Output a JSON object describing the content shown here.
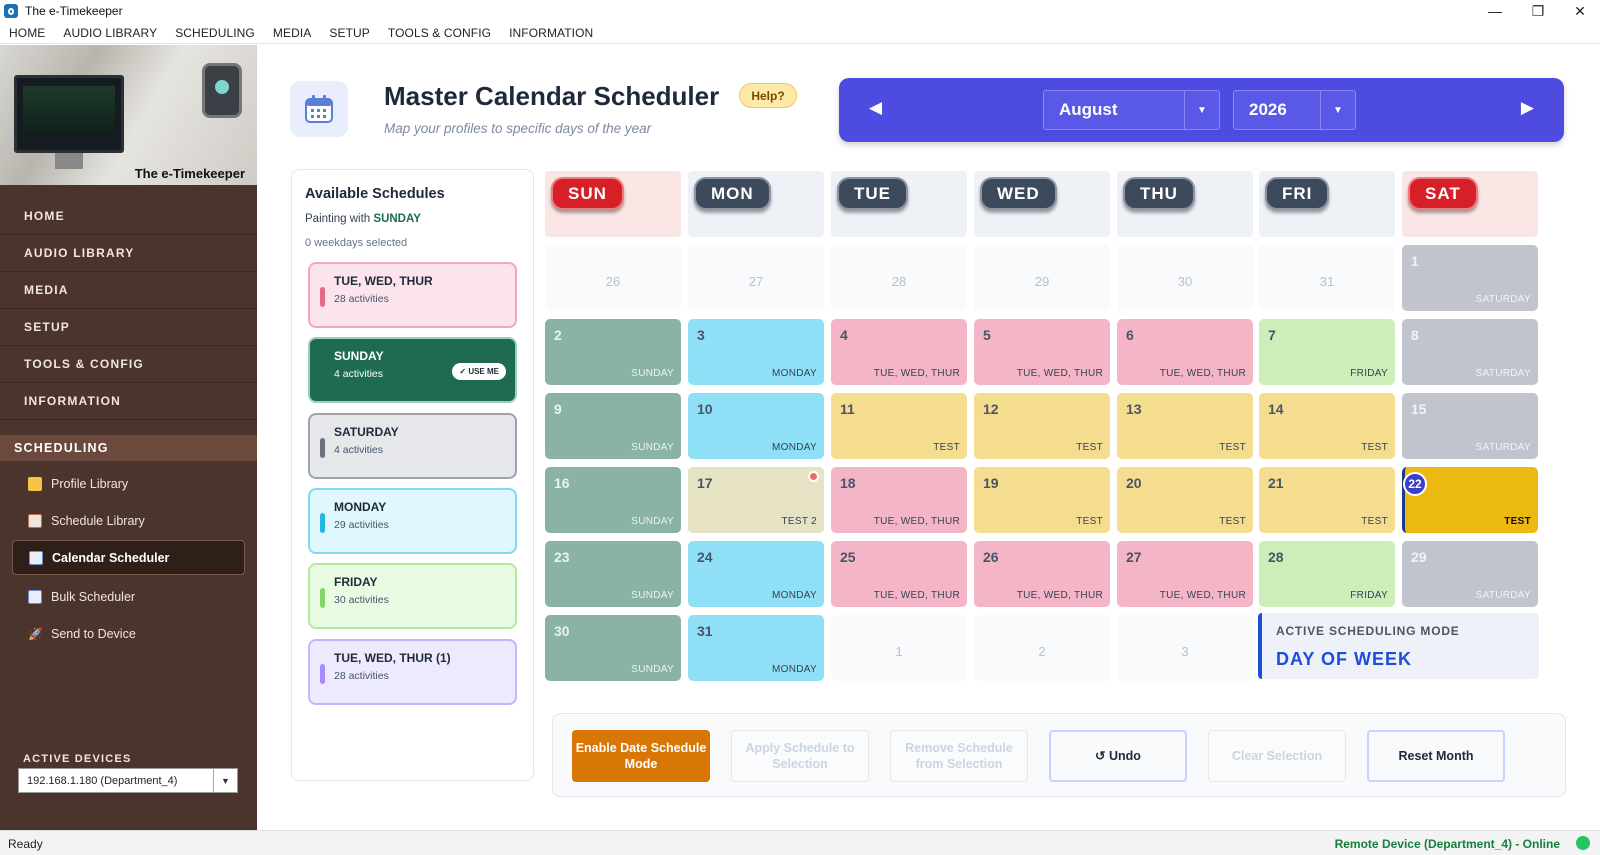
{
  "window": {
    "title": "The e-Timekeeper",
    "minimize": "—",
    "maximize": "❐",
    "close": "✕"
  },
  "menubar": [
    "HOME",
    "AUDIO LIBRARY",
    "SCHEDULING",
    "MEDIA",
    "SETUP",
    "TOOLS & CONFIG",
    "INFORMATION"
  ],
  "sidebar": {
    "banner_label": "The e-Timekeeper",
    "nav": [
      "HOME",
      "AUDIO LIBRARY",
      "MEDIA",
      "SETUP",
      "TOOLS & CONFIG",
      "INFORMATION"
    ],
    "section": "SCHEDULING",
    "sub_items": [
      {
        "label": "Profile Library",
        "icon": "folder-icon",
        "color": "#f5c542"
      },
      {
        "label": "Schedule Library",
        "icon": "document-icon",
        "color": "#f1e6dc"
      },
      {
        "label": "Calendar Scheduler",
        "icon": "calendar-icon",
        "color": "#9bb7e6"
      },
      {
        "label": "Bulk Scheduler",
        "icon": "calendar-icon",
        "color": "#9bb7e6"
      },
      {
        "label": "Send to Device",
        "icon": "rocket-icon",
        "color": "#e26b6b"
      }
    ],
    "active_devices_label": "ACTIVE DEVICES",
    "device_value": "192.168.1.180  (Department_4)"
  },
  "header": {
    "title": "Master Calendar Scheduler",
    "help": "Help?",
    "subtitle": "Map your profiles to specific days of the year"
  },
  "month_nav": {
    "month": "August",
    "year": "2026",
    "prev": "◀",
    "next": "▶"
  },
  "available": {
    "title": "Available Schedules",
    "painting_prefix": "Painting with ",
    "painting_value": "SUNDAY",
    "weekdays_selected": "0 weekdays selected",
    "use_me": "✓ USE ME",
    "cards": [
      {
        "name": "TUE, WED, THUR",
        "activities": "28 activities",
        "bg": "#fce4ec",
        "border": "#f4a6bd",
        "bar": "#e36b8a"
      },
      {
        "name": "SUNDAY",
        "activities": "4 activities",
        "bg": "#1e6b52",
        "border": "#9ad0bf",
        "bar": "#1e6b52",
        "selected": true
      },
      {
        "name": "SATURDAY",
        "activities": "4 activities",
        "bg": "#e5e7eb",
        "border": "#9ca3af",
        "bar": "#6b7280"
      },
      {
        "name": "MONDAY",
        "activities": "29 activities",
        "bg": "#e0f7fd",
        "border": "#7fdaf2",
        "bar": "#22b8e0"
      },
      {
        "name": "FRIDAY",
        "activities": "30 activities",
        "bg": "#eafbe4",
        "border": "#b6e8a3",
        "bar": "#86d36a"
      },
      {
        "name": "TUE, WED, THUR (1)",
        "activities": "28 activities",
        "bg": "#ede9fe",
        "border": "#c4b5fd",
        "bar": "#a78bfa"
      }
    ]
  },
  "calendar": {
    "day_headers": [
      "SUN",
      "MON",
      "TUE",
      "WED",
      "THU",
      "FRI",
      "SAT"
    ],
    "days": [
      {
        "n": "26",
        "t": "other",
        "l": ""
      },
      {
        "n": "27",
        "t": "other",
        "l": ""
      },
      {
        "n": "28",
        "t": "other",
        "l": ""
      },
      {
        "n": "29",
        "t": "other",
        "l": ""
      },
      {
        "n": "30",
        "t": "other",
        "l": ""
      },
      {
        "n": "31",
        "t": "other",
        "l": ""
      },
      {
        "n": "1",
        "t": "sat",
        "l": "SATURDAY"
      },
      {
        "n": "2",
        "t": "sun",
        "l": "SUNDAY"
      },
      {
        "n": "3",
        "t": "mon",
        "l": "MONDAY"
      },
      {
        "n": "4",
        "t": "tue",
        "l": "TUE, WED, THUR"
      },
      {
        "n": "5",
        "t": "tue",
        "l": "TUE, WED, THUR"
      },
      {
        "n": "6",
        "t": "tue",
        "l": "TUE, WED, THUR"
      },
      {
        "n": "7",
        "t": "fri",
        "l": "FRIDAY"
      },
      {
        "n": "8",
        "t": "sat",
        "l": "SATURDAY"
      },
      {
        "n": "9",
        "t": "sun",
        "l": "SUNDAY"
      },
      {
        "n": "10",
        "t": "mon",
        "l": "MONDAY"
      },
      {
        "n": "11",
        "t": "test",
        "l": "TEST"
      },
      {
        "n": "12",
        "t": "test",
        "l": "TEST"
      },
      {
        "n": "13",
        "t": "test",
        "l": "TEST"
      },
      {
        "n": "14",
        "t": "test",
        "l": "TEST"
      },
      {
        "n": "15",
        "t": "sat",
        "l": "SATURDAY"
      },
      {
        "n": "16",
        "t": "sun",
        "l": "SUNDAY"
      },
      {
        "n": "17",
        "t": "test2",
        "l": "TEST 2"
      },
      {
        "n": "18",
        "t": "tue",
        "l": "TUE, WED, THUR"
      },
      {
        "n": "19",
        "t": "test",
        "l": "TEST"
      },
      {
        "n": "20",
        "t": "test",
        "l": "TEST"
      },
      {
        "n": "21",
        "t": "test",
        "l": "TEST"
      },
      {
        "n": "22",
        "t": "today",
        "l": "TEST"
      },
      {
        "n": "23",
        "t": "sun",
        "l": "SUNDAY"
      },
      {
        "n": "24",
        "t": "mon",
        "l": "MONDAY"
      },
      {
        "n": "25",
        "t": "tue",
        "l": "TUE, WED, THUR"
      },
      {
        "n": "26",
        "t": "tue",
        "l": "TUE, WED, THUR"
      },
      {
        "n": "27",
        "t": "tue",
        "l": "TUE, WED, THUR"
      },
      {
        "n": "28",
        "t": "fri",
        "l": "FRIDAY"
      },
      {
        "n": "29",
        "t": "sat",
        "l": "SATURDAY"
      },
      {
        "n": "30",
        "t": "sun",
        "l": "SUNDAY"
      },
      {
        "n": "31",
        "t": "mon",
        "l": "MONDAY"
      },
      {
        "n": "1",
        "t": "other",
        "l": ""
      },
      {
        "n": "2",
        "t": "other",
        "l": ""
      },
      {
        "n": "3",
        "t": "other",
        "l": ""
      }
    ],
    "mode_label": "ACTIVE SCHEDULING MODE",
    "mode_value": "DAY OF WEEK"
  },
  "actions": [
    {
      "label": "Enable Date Schedule Mode",
      "style": "primary"
    },
    {
      "label": "Apply Schedule to Selection",
      "style": "disabled"
    },
    {
      "label": "Remove Schedule from Selection",
      "style": "disabled"
    },
    {
      "label": "↺ Undo",
      "style": "outline"
    },
    {
      "label": "Clear Selection",
      "style": "disabled"
    },
    {
      "label": "Reset Month",
      "style": "outline"
    }
  ],
  "status": {
    "left": "Ready",
    "right": "Remote Device (Department_4) - Online"
  }
}
